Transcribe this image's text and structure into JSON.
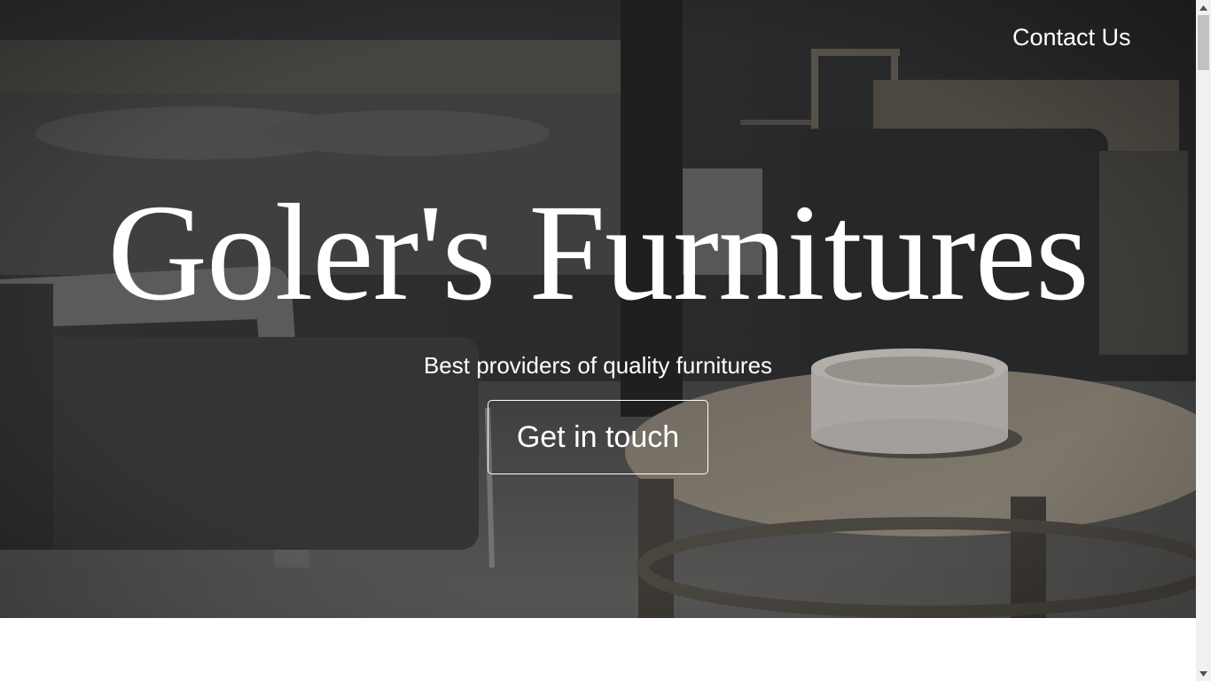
{
  "page": {
    "background": "#ffffff"
  },
  "nav": {
    "contact_label": "Contact Us"
  },
  "hero": {
    "title": "Goler's Furnitures",
    "subtitle": "Best providers of quality furnitures",
    "cta_label": "Get in touch",
    "overlay_color": "#3b3c3e",
    "text_color": "#ffffff"
  },
  "scrollbar": {
    "up_icon": "triangle-up-icon",
    "down_icon": "triangle-down-icon",
    "track_color": "#f1f1f1",
    "thumb_color": "#c1c1c1"
  }
}
